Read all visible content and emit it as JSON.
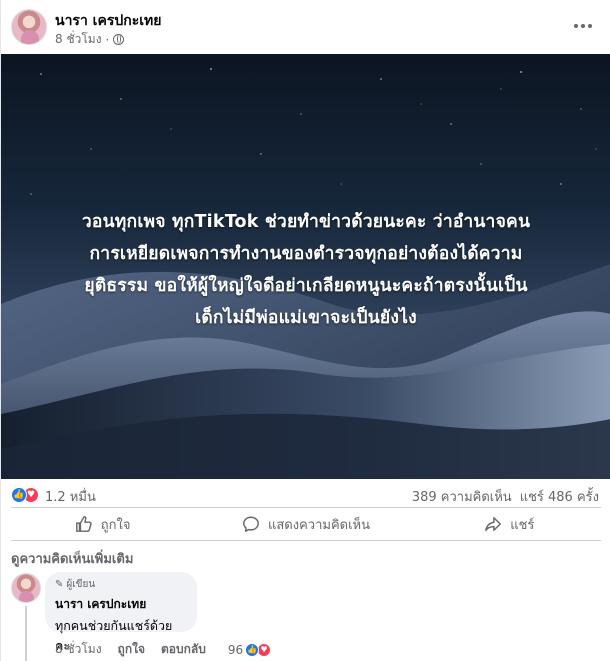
{
  "post": {
    "author": "นารา เครปกะเทย",
    "time": "8 ชั่วโมง",
    "privacy_icon": "globe-icon",
    "image_text": "วอนทุกเพจ ทุกTikTok ช่วยทำข่าวด้วยนะคะ ว่าอำนาจคนการเหยียดเพจการทำงานของตำรวจทุกอย่างต้องได้ความยุติธรรม ขอให้ผู้ใหญ่ใจดีอย่าเกลียดหนูนะคะถ้าตรงนั้นเป็นเด็กไม่มีพ่อแม่เขาจะเป็นยังไง",
    "image_lines": [
      "วอนทุกเพจ ทุกTikTok ช่วยทำข่าวด้วยนะคะ ว่าอำนาจคน",
      "การเหยียดเพจการทำงานของตำรวจทุกอย่างต้องได้ความ",
      "ยุติธรรม ขอให้ผู้ใหญ่ใจดีอย่าเกลียดหนูนะคะถ้าตรงนั้นเป็น",
      "เด็กไม่มีพ่อแม่เขาจะเป็นยังไง"
    ]
  },
  "stats": {
    "reactions": "1.2 หมื่น",
    "comments": "389 ความคิดเห็น",
    "shares": "แชร์ 486 ครั้ง"
  },
  "actions": {
    "like": "ถูกใจ",
    "comment": "แสดงความคิดเห็น",
    "share": "แชร์"
  },
  "view_more": "ดูความคิดเห็นเพิ่มเติม",
  "comment": {
    "badge": "ผู้เขียน",
    "author": "นารา เครปกะเทย",
    "text": "ทุกคนช่วยกันแชร์ด้วยคะ",
    "time": "8 ชั่วโมง",
    "like": "ถูกใจ",
    "reply": "ตอบกลับ",
    "reaction_count": "96"
  },
  "colors": {
    "like_blue": "#1877f2",
    "love_red": "#f33e58",
    "secondary_text": "#65676b"
  }
}
